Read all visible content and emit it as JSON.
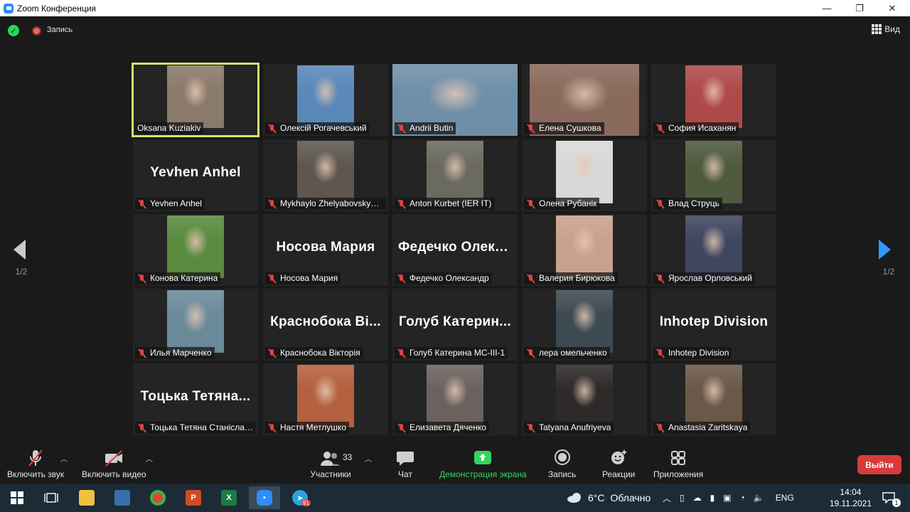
{
  "window": {
    "title": "Zoom Конференция",
    "minimize": "—",
    "restore": "❐",
    "close": "✕"
  },
  "topbar": {
    "record_label": "Запись",
    "view_label": "Вид"
  },
  "pager": {
    "left": "1/2",
    "right": "1/2"
  },
  "participants": [
    {
      "name": "Oksana Kuziakiv",
      "video": true,
      "active": true,
      "muted": false,
      "photo": "#8a7a6a"
    },
    {
      "name": "Олексій Рогачевський",
      "video": true,
      "muted": true,
      "photo": "#5a88b8"
    },
    {
      "name": "Andrii Butin",
      "video": true,
      "muted": true,
      "photo": "#6f8fa8",
      "wide": true
    },
    {
      "name": "Елена Сушкова",
      "video": true,
      "muted": true,
      "photo": "#8a6a5c",
      "mid": true
    },
    {
      "name": "София Исаханян",
      "video": true,
      "muted": true,
      "photo": "#b04a4a"
    },
    {
      "name": "Yevhen Anhel",
      "video": false,
      "muted": true,
      "big": "Yevhen Anhel"
    },
    {
      "name": "Mykhaylo Zhelyabovskyy ...",
      "video": true,
      "muted": true,
      "photo": "#5d574f"
    },
    {
      "name": "Anton Kurbet (IER IT)",
      "video": true,
      "muted": true,
      "photo": "#6b6a60"
    },
    {
      "name": "Олена Рубанік",
      "video": true,
      "muted": true,
      "photo": "#d8d8d8"
    },
    {
      "name": "Влад Струць",
      "video": true,
      "muted": true,
      "photo": "#4f5a3e"
    },
    {
      "name": "Конова Катерина",
      "video": true,
      "muted": true,
      "photo": "#5a8a3e"
    },
    {
      "name": "Носова Мария",
      "video": false,
      "muted": true,
      "big": "Носова Мария"
    },
    {
      "name": "Федечко Олександр",
      "video": false,
      "muted": true,
      "big": "Федечко Олекс..."
    },
    {
      "name": "Валерия Бирюкова",
      "video": true,
      "muted": true,
      "photo": "#c9a08c"
    },
    {
      "name": "Ярослав Орловський",
      "video": true,
      "muted": true,
      "photo": "#3e4660"
    },
    {
      "name": "Илья Марченко",
      "video": true,
      "muted": true,
      "photo": "#6a8a9a"
    },
    {
      "name": "Краснобока Вікторія",
      "video": false,
      "muted": true,
      "big": "Краснобока Ві..."
    },
    {
      "name": "Голуб Катерина МС-ІІІ-1",
      "video": false,
      "muted": true,
      "big": "Голуб Катерин..."
    },
    {
      "name": "лера омельченко",
      "video": true,
      "muted": true,
      "photo": "#3e4a52"
    },
    {
      "name": "Inhotep Division",
      "video": false,
      "muted": true,
      "big": "Inhotep Division"
    },
    {
      "name": "Тоцька Тетяна Станіслав...",
      "video": false,
      "muted": true,
      "big": "Тоцька Тетяна..."
    },
    {
      "name": "Настя Метлушко",
      "video": true,
      "muted": true,
      "photo": "#b5603e"
    },
    {
      "name": "Елизавета Дяченко",
      "video": true,
      "muted": true,
      "photo": "#6a625e"
    },
    {
      "name": "Tatyana Anufriyeva",
      "video": true,
      "muted": true,
      "photo": "#2e2a2a"
    },
    {
      "name": "Anastasia Zaritskaya",
      "video": true,
      "muted": true,
      "photo": "#6a5848"
    }
  ],
  "toolbar": {
    "audio": "Включить звук",
    "video": "Включить видео",
    "participants": "Участники",
    "participants_count": "33",
    "chat": "Чат",
    "share": "Демонстрация экрана",
    "record": "Запись",
    "reactions": "Реакции",
    "apps": "Приложения",
    "leave": "Выйти"
  },
  "taskbar": {
    "weather_temp": "6°C",
    "weather_text": "Облачно",
    "lang": "ENG",
    "time": "14:04",
    "date": "19.11.2021",
    "telegram_badge": "91",
    "notif_count": "1"
  },
  "colors": {
    "active_outline": "#cfe66c",
    "share_green": "#33d45e",
    "leave_red": "#d93b3b",
    "mute_red": "#e04242",
    "next_arrow": "#2d9cff"
  }
}
